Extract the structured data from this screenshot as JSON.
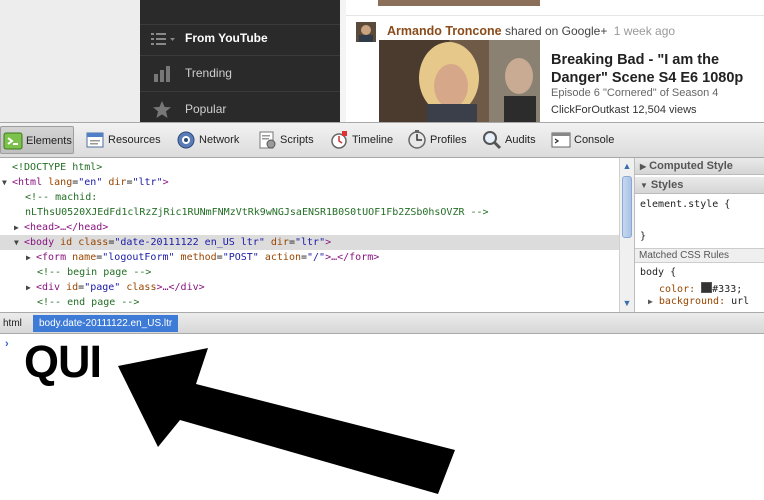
{
  "youtube": {
    "guide": [
      {
        "label": "From YouTube",
        "icon": "list-icon",
        "active": true
      },
      {
        "label": "Trending",
        "icon": "bar-chart-icon",
        "active": false
      },
      {
        "label": "Popular",
        "icon": "star-icon",
        "active": false
      }
    ],
    "share": {
      "author": "Armando Troncone",
      "action": "shared on Google+",
      "ago": "1 week ago"
    },
    "video": {
      "title": "Breaking Bad - \"I am the Danger\" Scene S4 E6 1080p",
      "subtitle": "Episode 6 \"Cornered\" of Season 4",
      "channel": "ClickForOutkast",
      "views": "12,504 views"
    }
  },
  "devtools": {
    "tabs": [
      {
        "label": "Elements",
        "icon": "elements-icon",
        "active": true
      },
      {
        "label": "Resources",
        "icon": "resources-icon",
        "active": false
      },
      {
        "label": "Network",
        "icon": "network-icon",
        "active": false
      },
      {
        "label": "Scripts",
        "icon": "scripts-icon",
        "active": false
      },
      {
        "label": "Timeline",
        "icon": "timeline-icon",
        "active": false
      },
      {
        "label": "Profiles",
        "icon": "profiles-icon",
        "active": false
      },
      {
        "label": "Audits",
        "icon": "audits-icon",
        "active": false
      },
      {
        "label": "Console",
        "icon": "console-icon",
        "active": false
      }
    ],
    "dom": {
      "doctype": "<!DOCTYPE html>",
      "html_open": "<html",
      "html_lang_attr": "lang",
      "html_lang_val": "\"en\"",
      "html_dir_attr": "dir",
      "html_dir_val": "\"ltr\"",
      "html_close": ">",
      "comment1": "<!-- machid:",
      "comment2": "nLThsU0520XJEdFd1clRzZjRic1RUNmFNMzVtRk9wNGJsaENSR1B0S0tUOF1Fb2ZSb0hsOVZR -->",
      "head_line": "<head>…</head>",
      "body_open": "<body",
      "body_id_attr": "id",
      "body_class_attr": "class",
      "body_class_val": "\"date-20111122 en_US ltr\"",
      "body_dir_attr": "dir",
      "body_dir_val": "\"ltr\"",
      "body_close": ">",
      "form_open": "<form",
      "form_name_attr": "name",
      "form_name_val": "\"logoutForm\"",
      "form_method_attr": "method",
      "form_method_val": "\"POST\"",
      "form_action_attr": "action",
      "form_action_val": "\"/\"",
      "form_close": ">…</form>",
      "comment_begin": "<!-- begin page -->",
      "div_open": "<div",
      "div_id_attr": "id",
      "div_id_val": "\"page\"",
      "div_class_attr": "class",
      "div_close": ">…</div>",
      "comment_end": "<!-- end page -->"
    },
    "sidebar": {
      "computed_style": "Computed Style",
      "styles": "Styles",
      "element_style": "element.style {",
      "brace_close": "}",
      "matched_rules": "Matched CSS Rules",
      "rule_selector": "body {",
      "color_prop": "color:",
      "color_val": "#333;",
      "bg_prop": "background:",
      "bg_val": "url"
    },
    "breadcrumbs": {
      "html": "html",
      "body": "body.date-20111122.en_US.ltr"
    },
    "console": {
      "prompt": "›",
      "text": "QUI"
    }
  },
  "colors": {
    "guide_bg": "#2a2a2a",
    "selected_crumb": "#3d7bd6",
    "swatch": "#333333"
  }
}
